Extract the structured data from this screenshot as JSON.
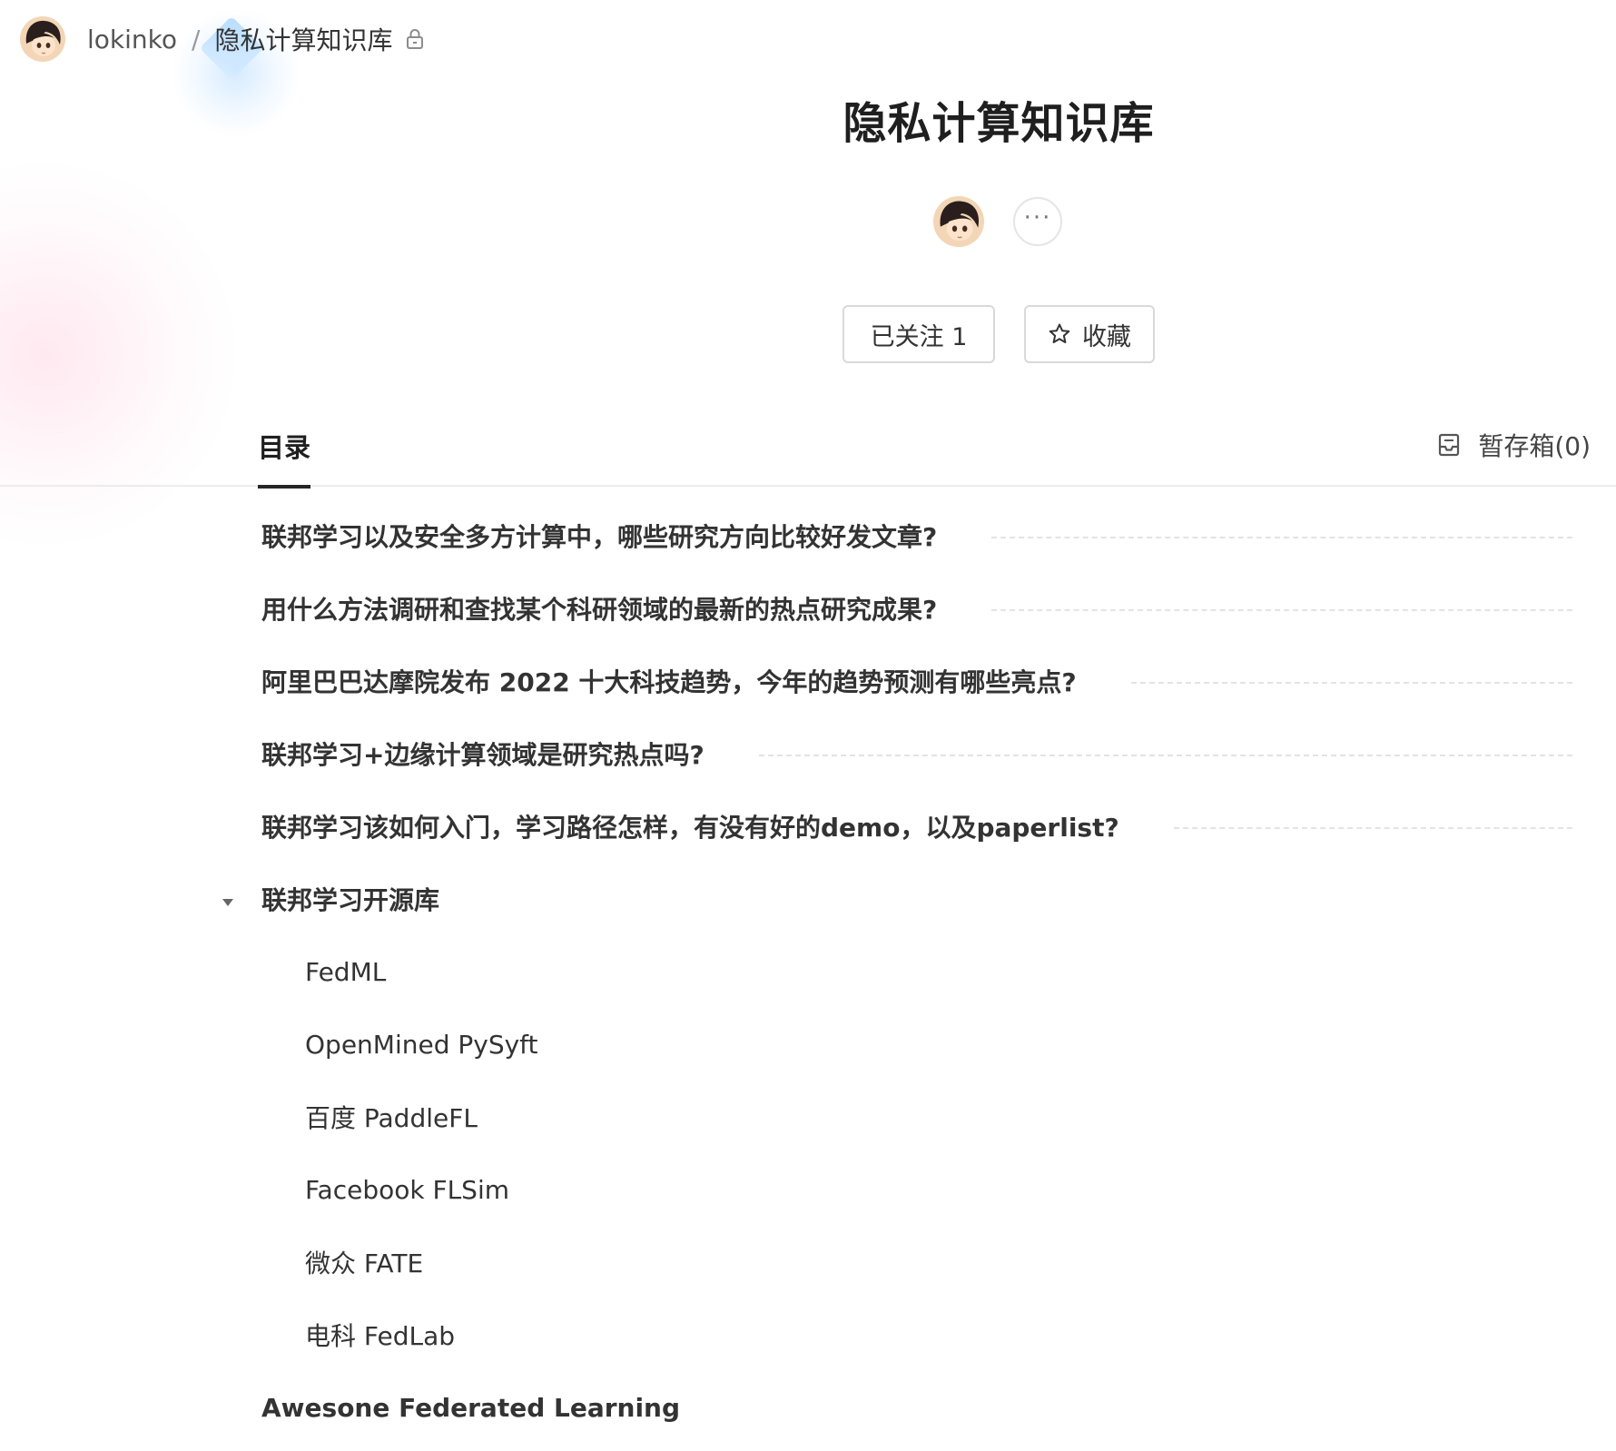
{
  "breadcrumb": {
    "user": "lokinko",
    "separator": "/",
    "book": "隐私计算知识库",
    "lock_icon": "lock-icon"
  },
  "book": {
    "title": "隐私计算知识库",
    "more": "···"
  },
  "actions": {
    "follow_label": "已关注 1",
    "collect_label": "收藏",
    "collect_icon": "star-icon"
  },
  "tabs": {
    "toc_label": "目录",
    "drafts_label": "暂存箱(0)",
    "drafts_icon": "inbox-icon"
  },
  "toc": {
    "items": [
      {
        "label": "联邦学习以及安全多方计算中，哪些研究方向比较好发文章?"
      },
      {
        "label": "用什么方法调研和查找某个科研领域的最新的热点研究成果?"
      },
      {
        "label": "阿里巴巴达摩院发布 2022 十大科技趋势，今年的趋势预测有哪些亮点?"
      },
      {
        "label": "联邦学习+边缘计算领域是研究热点吗?"
      },
      {
        "label": "联邦学习该如何入门，学习路径怎样，有没有好的demo，以及paperlist?"
      }
    ],
    "group": {
      "label": "联邦学习开源库",
      "expanded": true,
      "children": [
        {
          "label": "FedML"
        },
        {
          "label": "OpenMined PySyft"
        },
        {
          "label": "百度 PaddleFL"
        },
        {
          "label": "Facebook FLSim"
        },
        {
          "label": "微众 FATE"
        },
        {
          "label": "电科 FedLab"
        }
      ]
    },
    "last": {
      "label": "Awesone Federated Learning"
    }
  },
  "colors": {
    "text": "#262626",
    "muted": "#999999",
    "border": "#d9d9d9",
    "accent_glow_pink": "#ffd6e4",
    "accent_glow_blue": "#c8e4ff"
  }
}
